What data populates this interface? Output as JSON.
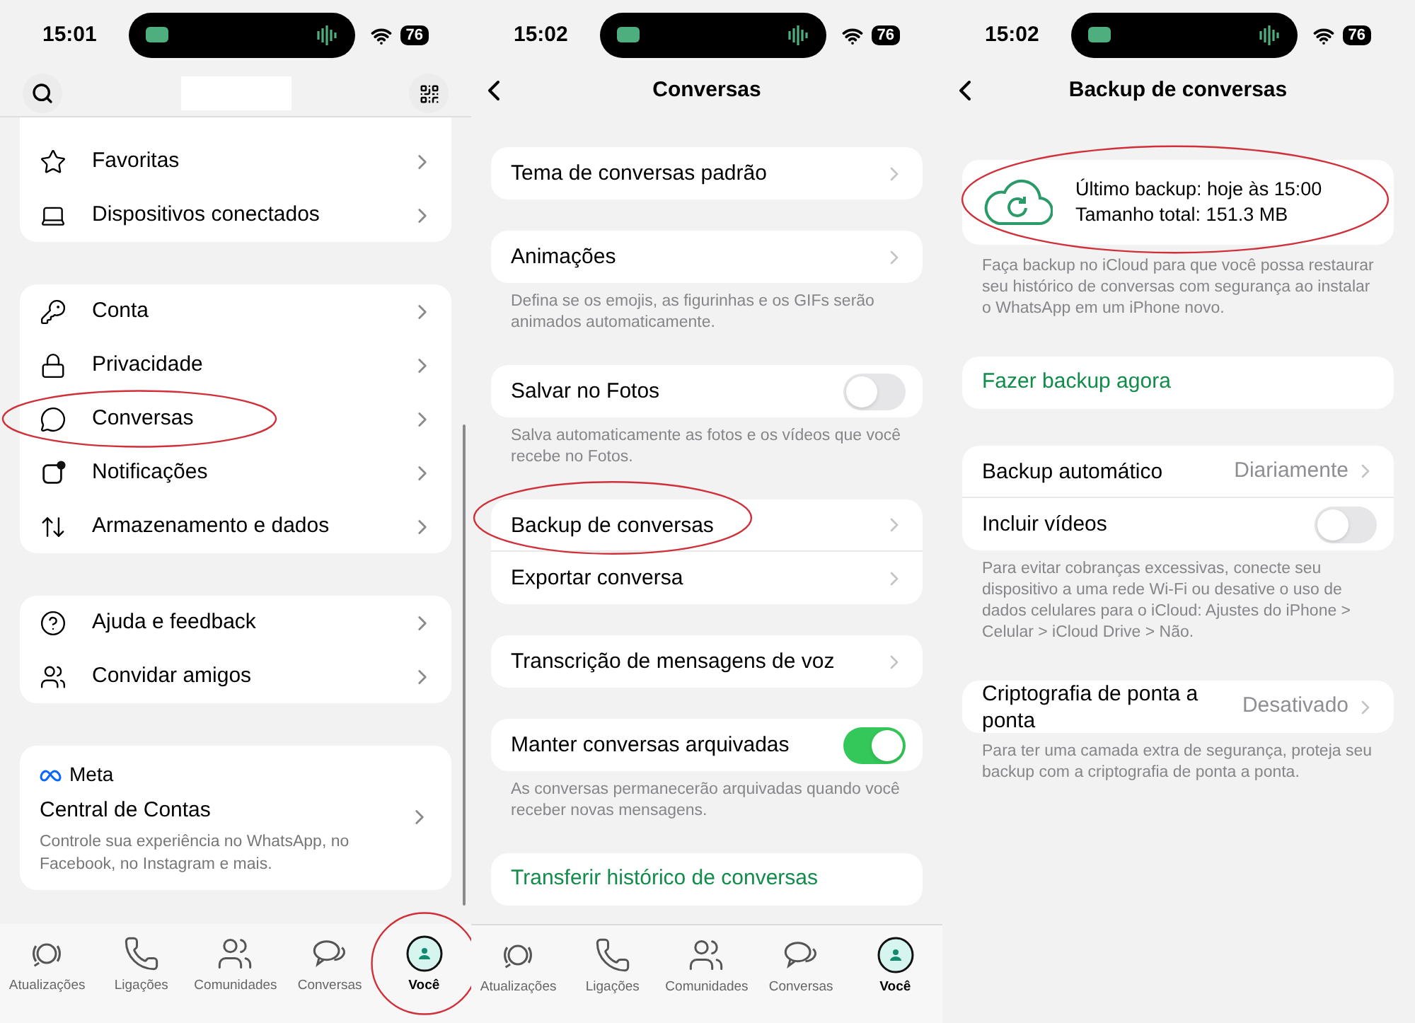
{
  "screens": [
    {
      "kind": "profile",
      "status": {
        "time": "15:01",
        "battery": "76"
      },
      "groups": [
        [
          {
            "label": "Favoritas",
            "annotated": false
          },
          {
            "label": "Dispositivos conectados",
            "annotated": false
          }
        ],
        [
          {
            "label": "Conta",
            "annotated": false
          },
          {
            "label": "Privacidade",
            "annotated": false
          },
          {
            "label": "Conversas",
            "annotated": true
          },
          {
            "label": "Notificações",
            "annotated": false
          },
          {
            "label": "Armazenamento e dados",
            "annotated": false
          }
        ],
        [
          {
            "label": "Ajuda e feedback",
            "annotated": false
          },
          {
            "label": "Convidar amigos",
            "annotated": false
          }
        ]
      ],
      "meta_card": {
        "brand": "Meta",
        "title": "Central de Contas",
        "description": "Controle sua experiência no WhatsApp, no Facebook, no Instagram e mais."
      },
      "tabs": [
        {
          "label": "Atualizações",
          "selected": false,
          "annotated": false
        },
        {
          "label": "Ligações",
          "selected": false,
          "annotated": false
        },
        {
          "label": "Comunidades",
          "selected": false,
          "annotated": false
        },
        {
          "label": "Conversas",
          "selected": false,
          "annotated": false
        },
        {
          "label": "Você",
          "selected": true,
          "annotated": true
        }
      ]
    },
    {
      "kind": "settings",
      "status": {
        "time": "15:02",
        "battery": "76"
      },
      "title": "Conversas",
      "groups": [
        {
          "rows": [
            {
              "kind": "nav",
              "label": "Tema de conversas padrão",
              "annotated": false
            }
          ]
        },
        {
          "rows": [
            {
              "kind": "nav",
              "label": "Animações",
              "annotated": false
            }
          ],
          "note": "Defina se os emojis, as figurinhas e os GIFs serão animados automaticamente."
        },
        {
          "rows": [
            {
              "kind": "toggle",
              "label": "Salvar no Fotos",
              "on": false,
              "annotated": false
            }
          ],
          "note": "Salva automaticamente as fotos e os vídeos que você recebe no Fotos."
        },
        {
          "rows": [
            {
              "kind": "nav",
              "label": "Backup de conversas",
              "annotated": true
            },
            {
              "kind": "nav",
              "label": "Exportar conversa",
              "annotated": false
            }
          ]
        },
        {
          "rows": [
            {
              "kind": "nav",
              "label": "Transcrição de mensagens de voz",
              "annotated": false
            }
          ]
        },
        {
          "rows": [
            {
              "kind": "toggle",
              "label": "Manter conversas arquivadas",
              "on": true,
              "annotated": false
            }
          ],
          "note": "As conversas permanecerão arquivadas quando você receber novas mensagens."
        },
        {
          "rows": [
            {
              "kind": "action",
              "label": "Transferir histórico de conversas",
              "annotated": false
            }
          ]
        }
      ],
      "tabs": [
        {
          "label": "Atualizações",
          "selected": false,
          "annotated": false
        },
        {
          "label": "Ligações",
          "selected": false,
          "annotated": false
        },
        {
          "label": "Comunidades",
          "selected": false,
          "annotated": false
        },
        {
          "label": "Conversas",
          "selected": false,
          "annotated": false
        },
        {
          "label": "Você",
          "selected": true,
          "annotated": false
        }
      ]
    },
    {
      "kind": "backup",
      "status": {
        "time": "15:02",
        "battery": "76"
      },
      "title": "Backup de conversas",
      "backup_card": {
        "last_backup": "Último backup: hoje às 15:00",
        "total_size": "Tamanho total: 151.3 MB",
        "annotated": true
      },
      "groups": [
        {
          "note": "Faça backup no iCloud para que você possa restaurar seu histórico de conversas com segurança ao instalar o WhatsApp em um iPhone novo."
        },
        {
          "rows": [
            {
              "kind": "action",
              "label": "Fazer backup agora",
              "annotated": false
            }
          ]
        },
        {
          "rows": [
            {
              "kind": "nav",
              "label": "Backup automático",
              "value": "Diariamente",
              "annotated": false
            },
            {
              "kind": "toggle",
              "label": "Incluir vídeos",
              "on": false,
              "annotated": false
            }
          ],
          "note": "Para evitar cobranças excessivas, conecte seu dispositivo a uma rede Wi-Fi ou desative o uso de dados celulares para o iCloud: Ajustes do iPhone > Celular > iCloud Drive > Não."
        },
        {
          "rows": [
            {
              "kind": "nav",
              "label": "Criptografia de ponta a ponta",
              "value": "Desativado",
              "annotated": false
            }
          ],
          "note": "Para ter uma camada extra de segurança, proteja seu backup com a criptografia de ponta a ponta."
        }
      ]
    }
  ]
}
